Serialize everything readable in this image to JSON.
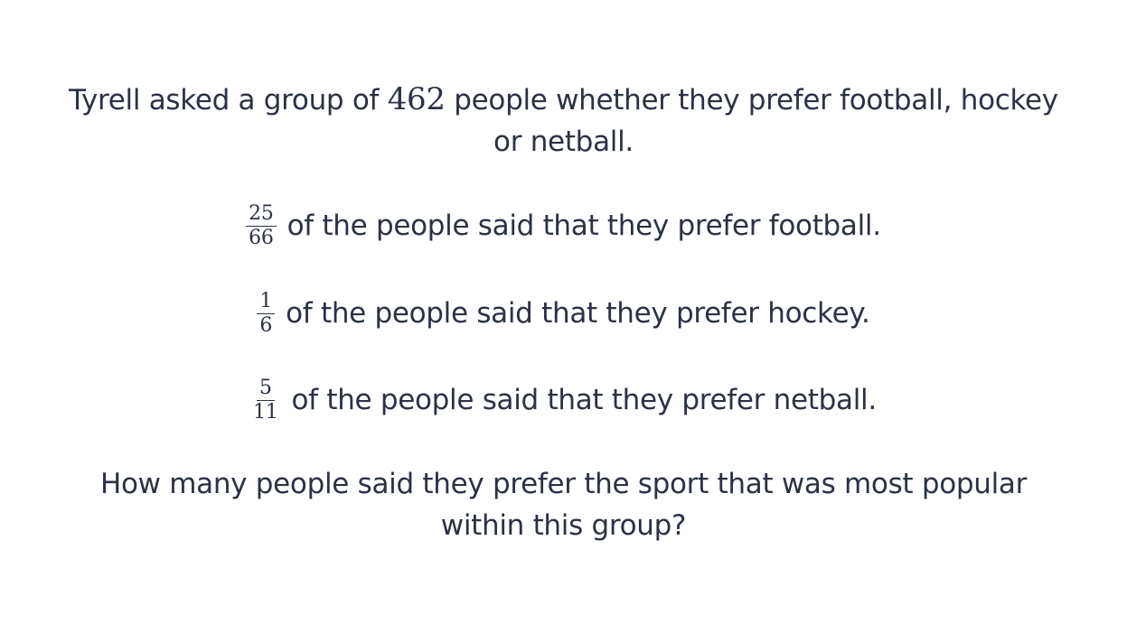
{
  "intro": {
    "before": "Tyrell asked a group of ",
    "number": "462",
    "after_line1": " people whether they prefer football, hockey",
    "line2": "or netball."
  },
  "statements": [
    {
      "numerator": "25",
      "denominator": "66",
      "text": "of the people said that they prefer football."
    },
    {
      "numerator": "1",
      "denominator": "6",
      "text": "of the people said that they prefer hockey."
    },
    {
      "numerator": "5",
      "denominator": "11",
      "text": "of the people said that they prefer netball."
    }
  ],
  "question": {
    "line1": "How many people said they prefer the sport that was most popular",
    "line2": "within this group?"
  }
}
